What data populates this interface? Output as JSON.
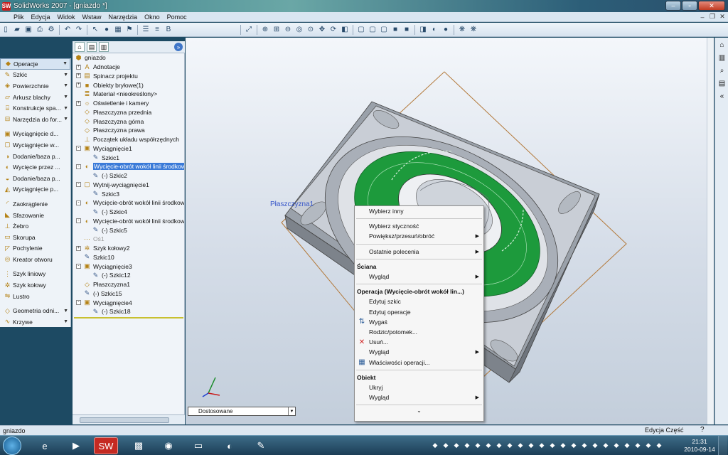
{
  "window": {
    "title": "SolidWorks 2007 - [gniazdo *]",
    "logo": "SW"
  },
  "menu": [
    "Plik",
    "Edycja",
    "Widok",
    "Wstaw",
    "Narzędzia",
    "Okno",
    "Pomoc"
  ],
  "command_manager": [
    {
      "label": "Operacje",
      "icon": "features-icon",
      "dropdown": true,
      "active": true
    },
    {
      "label": "Szkic",
      "icon": "sketch-icon",
      "dropdown": true
    },
    {
      "label": "Powierzchnie",
      "icon": "surfaces-icon",
      "dropdown": true
    },
    {
      "label": "Arkusz blachy",
      "icon": "sheetmetal-icon",
      "dropdown": true
    },
    {
      "label": "Konstrukcje spa...",
      "icon": "weldments-icon",
      "dropdown": true
    },
    {
      "label": "Narzędzia do for...",
      "icon": "mold-tools-icon",
      "dropdown": true
    },
    {
      "sep": true
    },
    {
      "label": "Wyciągnięcie d...",
      "icon": "extrude-boss-icon"
    },
    {
      "label": "Wyciągnięcie w...",
      "icon": "extrude-cut-icon"
    },
    {
      "label": "Dodanie/baza p...",
      "icon": "revolve-boss-icon"
    },
    {
      "label": "Wycięcie przez ...",
      "icon": "revolve-cut-icon"
    },
    {
      "label": "Dodanie/baza p...",
      "icon": "sweep-boss-icon"
    },
    {
      "label": "Wyciągnięcie p...",
      "icon": "loft-icon"
    },
    {
      "sep": true
    },
    {
      "label": "Zaokrąglenie",
      "icon": "fillet-icon"
    },
    {
      "label": "Sfazowanie",
      "icon": "chamfer-icon"
    },
    {
      "label": "Żebro",
      "icon": "rib-icon"
    },
    {
      "label": "Skorupa",
      "icon": "shell-icon"
    },
    {
      "label": "Pochylenie",
      "icon": "draft-icon"
    },
    {
      "label": "Kreator otworu",
      "icon": "hole-wizard-icon"
    },
    {
      "sep": true
    },
    {
      "label": "Szyk liniowy",
      "icon": "linear-pattern-icon"
    },
    {
      "label": "Szyk kołowy",
      "icon": "circular-pattern-icon"
    },
    {
      "label": "Lustro",
      "icon": "mirror-icon"
    },
    {
      "sep": true
    },
    {
      "label": "Geometria odni...",
      "icon": "reference-geometry-icon",
      "dropdown": true
    },
    {
      "label": "Krzywe",
      "icon": "curves-icon",
      "dropdown": true
    }
  ],
  "feature_tree": [
    {
      "label": "gniazdo",
      "level": 0,
      "icon": "part-icon"
    },
    {
      "label": "Adnotacje",
      "level": 1,
      "icon": "annotations-icon",
      "toggle": "+"
    },
    {
      "label": "Spinacz projektu",
      "level": 1,
      "icon": "design-binder-icon",
      "toggle": "+"
    },
    {
      "label": "Obiekty bryłowe(1)",
      "level": 1,
      "icon": "solid-bodies-icon",
      "toggle": "+"
    },
    {
      "label": "Materiał <nieokreślony>",
      "level": 1,
      "icon": "material-icon"
    },
    {
      "label": "Oświetlenie i kamery",
      "level": 1,
      "icon": "lights-icon",
      "toggle": "+"
    },
    {
      "label": "Płaszczyzna przednia",
      "level": 1,
      "icon": "plane-icon"
    },
    {
      "label": "Płaszczyzna górna",
      "level": 1,
      "icon": "plane-icon"
    },
    {
      "label": "Płaszczyzna prawa",
      "level": 1,
      "icon": "plane-icon"
    },
    {
      "label": "Początek układu współrzędnych",
      "level": 1,
      "icon": "origin-icon"
    },
    {
      "label": "Wyciągnięcie1",
      "level": 1,
      "icon": "extrude-icon",
      "toggle": "-"
    },
    {
      "label": "Szkic1",
      "level": 2,
      "icon": "sketch-icon"
    },
    {
      "label": "Wycięcie-obrót wokół linii środkowej",
      "level": 1,
      "icon": "revolve-cut-icon",
      "toggle": "-",
      "selected": true
    },
    {
      "label": "(-) Szkic2",
      "level": 2,
      "icon": "sketch-icon"
    },
    {
      "label": "Wytnij-wyciągnięcie1",
      "level": 1,
      "icon": "cut-extrude-icon",
      "toggle": "-"
    },
    {
      "label": "Szkic3",
      "level": 2,
      "icon": "sketch-icon"
    },
    {
      "label": "Wycięcie-obrót wokół linii środkowej",
      "level": 1,
      "icon": "revolve-cut-icon",
      "toggle": "-"
    },
    {
      "label": "(-) Szkic4",
      "level": 2,
      "icon": "sketch-icon"
    },
    {
      "label": "Wycięcie-obrót wokół linii środkowej",
      "level": 1,
      "icon": "revolve-cut-icon",
      "toggle": "-"
    },
    {
      "label": "(-) Szkic5",
      "level": 2,
      "icon": "sketch-icon"
    },
    {
      "label": "Oś1",
      "level": 1,
      "icon": "axis-icon",
      "grey": true
    },
    {
      "label": "Szyk kołowy2",
      "level": 1,
      "icon": "circular-pattern-icon",
      "toggle": "+"
    },
    {
      "label": "Szkic10",
      "level": 1,
      "icon": "sketch-icon"
    },
    {
      "label": "Wyciągnięcie3",
      "level": 1,
      "icon": "extrude-icon",
      "toggle": "-"
    },
    {
      "label": "(-) Szkic12",
      "level": 2,
      "icon": "sketch-icon"
    },
    {
      "label": "Płaszczyzna1",
      "level": 1,
      "icon": "plane-icon"
    },
    {
      "label": "(-) Szkic15",
      "level": 1,
      "icon": "sketch-icon"
    },
    {
      "label": "Wyciągnięcie4",
      "level": 1,
      "icon": "extrude-icon",
      "toggle": "-"
    },
    {
      "label": "(-) Szkic18",
      "level": 2,
      "icon": "sketch-icon"
    }
  ],
  "graphics": {
    "plane_label": "Płaszczyzna1",
    "view_select": "Dostosowane"
  },
  "context_menu": [
    {
      "label": "Wybierz inny"
    },
    {
      "sep": true
    },
    {
      "label": "Wybierz styczność"
    },
    {
      "label": "Powiększ/przesuń/obróć",
      "sub": true
    },
    {
      "sep": true
    },
    {
      "label": "Ostatnie polecenia",
      "sub": true
    },
    {
      "sep": true
    },
    {
      "head": "Ściana"
    },
    {
      "label": "Wygląd",
      "sub": true
    },
    {
      "sep": true
    },
    {
      "head": "Operacja (Wycięcie-obrót wokół lin...)"
    },
    {
      "label": "Edytuj szkic"
    },
    {
      "label": "Edytuj operacje"
    },
    {
      "label": "Wygaś",
      "icon": "suppress-icon"
    },
    {
      "label": "Rodzic/potomek..."
    },
    {
      "label": "Usuń...",
      "icon": "delete-icon"
    },
    {
      "label": "Wygląd",
      "sub": true
    },
    {
      "label": "Właściwości operacji...",
      "icon": "properties-icon"
    },
    {
      "sep": true
    },
    {
      "head": "Obiekt"
    },
    {
      "label": "Ukryj"
    },
    {
      "label": "Wygląd",
      "sub": true
    },
    {
      "sep": true
    },
    {
      "more": "⌄"
    }
  ],
  "status": {
    "left": "gniazdo",
    "right": "Edycja Część",
    "help": "?"
  },
  "clock": {
    "time": "21:31",
    "date": "2010-09-14"
  },
  "colors": {
    "selection": "#3a7ad8",
    "face_green": "#1d9a3c",
    "part_grey": "#c8ccd2"
  }
}
